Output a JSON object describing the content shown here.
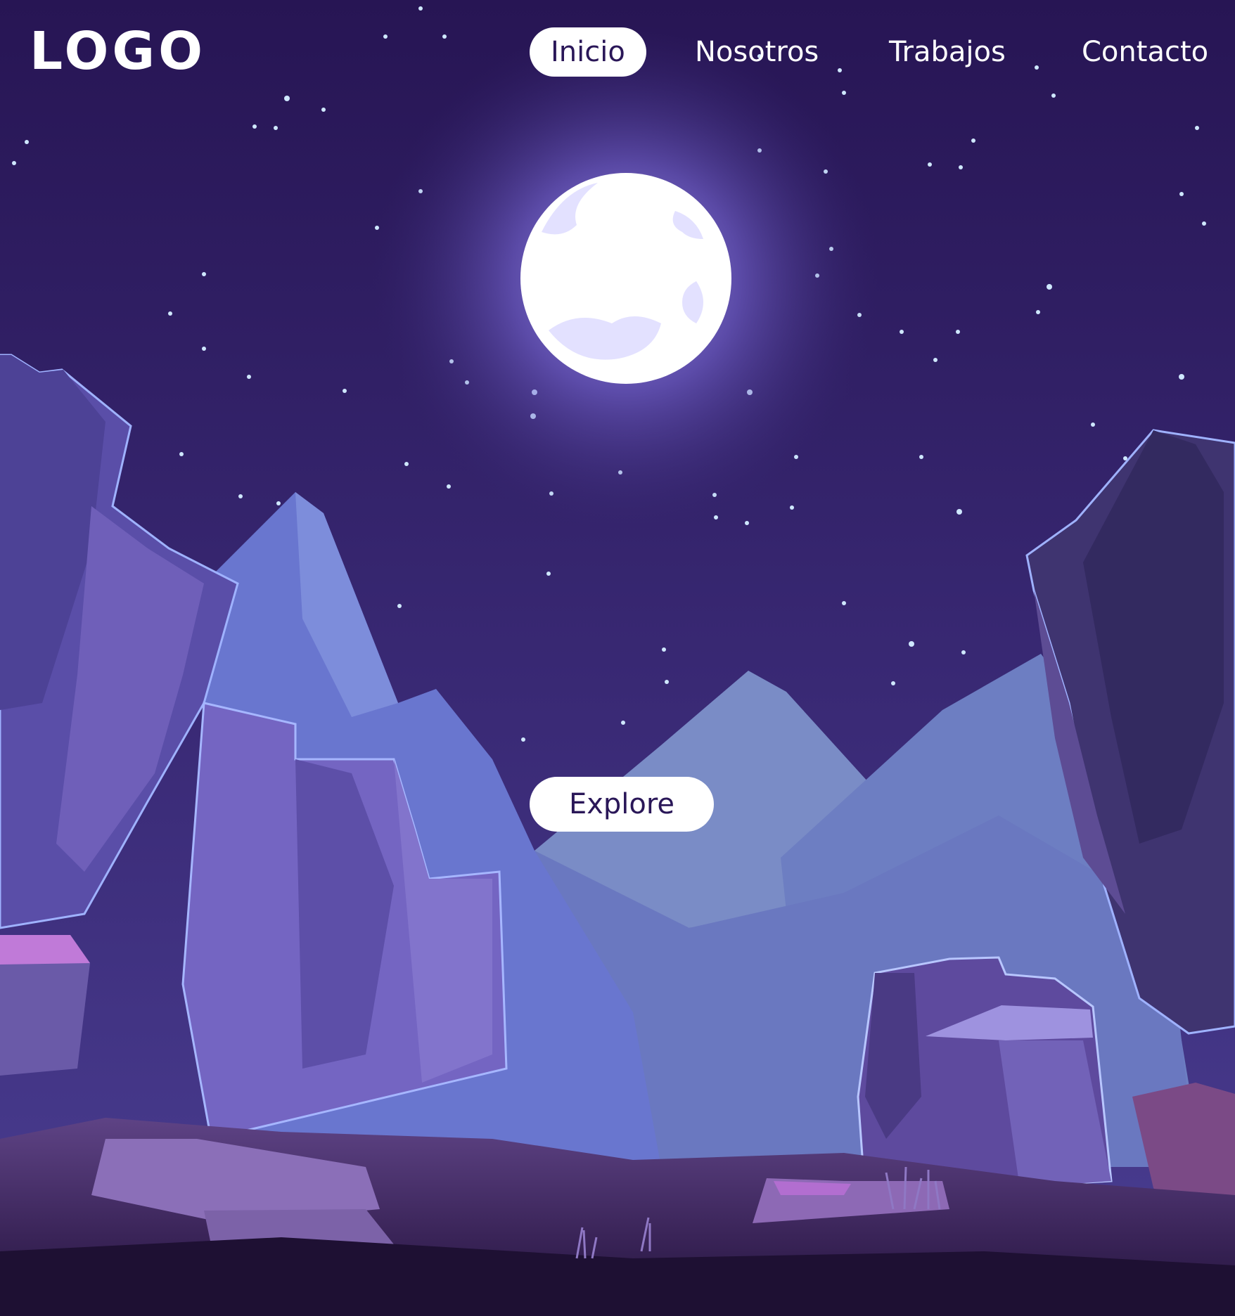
{
  "brand": {
    "logo_text": "LOGO"
  },
  "nav": {
    "items": [
      {
        "label": "Inicio",
        "active": true
      },
      {
        "label": "Nosotros",
        "active": false
      },
      {
        "label": "Trabajos",
        "active": false
      },
      {
        "label": "Contacto",
        "active": false
      }
    ]
  },
  "hero": {
    "cta_label": "Explore",
    "illustration": "night-mountain-landscape-with-full-moon"
  },
  "colors": {
    "sky": "#2a1758",
    "moon": "#ffffff",
    "accent_text": "#2a1758",
    "button_bg": "#ffffff"
  }
}
